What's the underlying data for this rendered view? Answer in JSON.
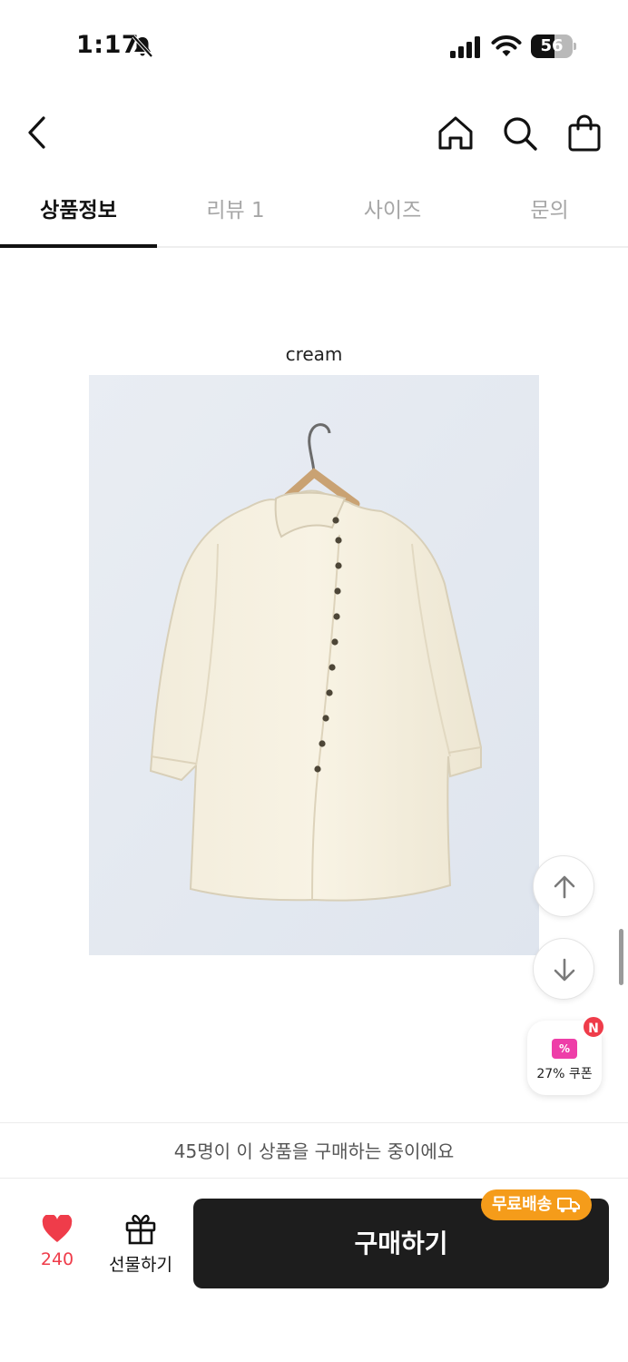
{
  "status_bar": {
    "time": "1:17",
    "battery": "56",
    "battery_level": 0.56
  },
  "header": {
    "icons": [
      "back-arrow-icon",
      "home-icon",
      "search-icon",
      "shopping-bag-icon"
    ]
  },
  "tabs": [
    {
      "label": "상품정보",
      "active": true
    },
    {
      "label": "리뷰 1",
      "active": false
    },
    {
      "label": "사이즈",
      "active": false
    },
    {
      "label": "문의",
      "active": false
    }
  ],
  "content": {
    "caption": "cream"
  },
  "floating": {
    "coupon_label": "27% 쿠폰",
    "coupon_icon_text": "%",
    "new_badge": "N"
  },
  "bottom": {
    "buyers_message": "45명이 이 상품을 구매하는 중이에요",
    "like_count": "240",
    "gift_label": "선물하기",
    "buy_label": "구매하기",
    "free_shipping_label": "무료배송"
  },
  "colors": {
    "accent_red": "#ef3c4a",
    "buy_button": "#1d1d1d",
    "free_shipping": "#f59c1a",
    "coupon": "#ee3ea8"
  }
}
